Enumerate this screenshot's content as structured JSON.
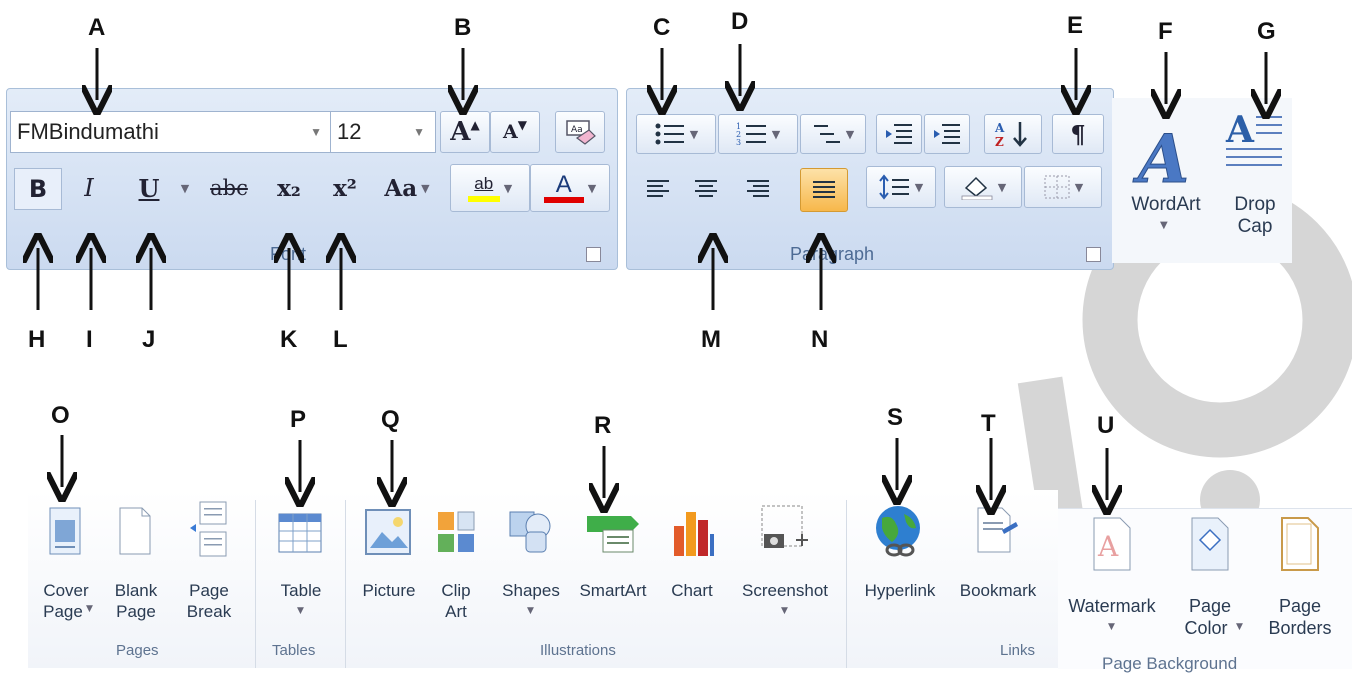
{
  "callouts": {
    "A": "A",
    "B": "B",
    "C": "C",
    "D": "D",
    "E": "E",
    "F": "F",
    "G": "G",
    "H": "H",
    "I": "I",
    "J": "J",
    "K": "K",
    "L": "L",
    "M": "M",
    "N": "N",
    "O": "O",
    "P": "P",
    "Q": "Q",
    "R": "R",
    "S": "S",
    "T": "T",
    "U": "U"
  },
  "font_group": {
    "font_name": "FMBindumathi",
    "font_size": "12",
    "label": "Font",
    "bold": "B",
    "italic": "I",
    "underline": "U",
    "strikethrough": "abc",
    "subscript": "x₂",
    "superscript": "x²",
    "change_case": "Aa",
    "grow": "A",
    "shrink": "A",
    "highlight": "ab",
    "font_color": "A"
  },
  "paragraph_group": {
    "label": "Paragraph",
    "show_marks": "¶"
  },
  "text_group": {
    "wordart": "WordArt",
    "dropcap_line1": "Drop",
    "dropcap_line2": "Cap"
  },
  "insert_ribbon": {
    "cover_page_1": "Cover",
    "cover_page_2": "Page",
    "blank_page_1": "Blank",
    "blank_page_2": "Page",
    "page_break_1": "Page",
    "page_break_2": "Break",
    "pages_label": "Pages",
    "table": "Table",
    "tables_label": "Tables",
    "picture": "Picture",
    "clip_art_1": "Clip",
    "clip_art_2": "Art",
    "shapes": "Shapes",
    "smartart": "SmartArt",
    "chart": "Chart",
    "screenshot": "Screenshot",
    "illustrations_label": "Illustrations",
    "hyperlink": "Hyperlink",
    "bookmark": "Bookmark",
    "links_label": "Links"
  },
  "page_layout": {
    "watermark": "Watermark",
    "page_color_1": "Page",
    "page_color_2": "Color",
    "page_borders_1": "Page",
    "page_borders_2": "Borders",
    "label": "Page Background"
  },
  "colors": {
    "ribbon_bg": "#cbdaf0",
    "highlight_yellow": "#ffff00",
    "font_red": "#e00000",
    "justify_active": "#f7b84b",
    "watermark_gray": "#cfcfcf"
  }
}
